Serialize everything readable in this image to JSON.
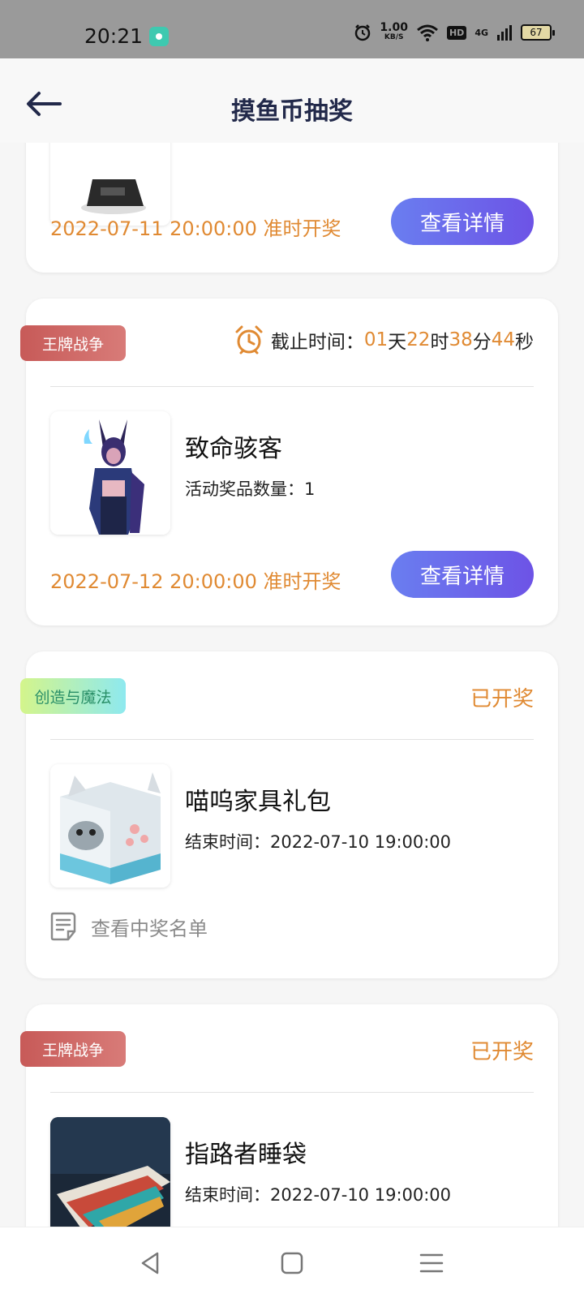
{
  "status_bar": {
    "time": "20:21",
    "speed_value": "1.00",
    "speed_unit": "KB/S",
    "hd": "HD",
    "network": "4G",
    "battery": "67",
    "icons": [
      "app-notification-icon",
      "alarm-icon",
      "wifi-icon",
      "signal-icon",
      "battery-icon"
    ]
  },
  "header": {
    "title": "摸鱼币抽奖",
    "back_icon": "back-arrow-icon"
  },
  "cards": [
    {
      "draw_time": "2022-07-11 20:00:00 准时开奖",
      "button": "查看详情"
    },
    {
      "tag": "王牌战争",
      "deadline_label": "截止时间：",
      "deadline": {
        "days": "01",
        "day_unit": "天",
        "hours": "22",
        "hour_unit": "时",
        "minutes": "38",
        "minute_unit": "分",
        "seconds": "44",
        "second_unit": "秒"
      },
      "name": "致命骇客",
      "sub": "活动奖品数量：1",
      "draw_time": "2022-07-12 20:00:00 准时开奖",
      "button": "查看详情"
    },
    {
      "tag": "创造与魔法",
      "status": "已开奖",
      "name": "喵呜家具礼包",
      "sub": "结束时间：2022-07-10 19:00:00",
      "winners_link": "查看中奖名单"
    },
    {
      "tag": "王牌战争",
      "status": "已开奖",
      "name": "指路者睡袋",
      "sub": "结束时间：2022-07-10 19:00:00"
    }
  ],
  "colors": {
    "accent_orange": "#e08a33",
    "button_gradient_start": "#6a7ef0",
    "button_gradient_end": "#6d53e6",
    "tag_red": "#c75a58",
    "title": "#22294a"
  },
  "nav": {
    "icons": [
      "back-triangle-icon",
      "home-square-icon",
      "menu-lines-icon"
    ]
  }
}
